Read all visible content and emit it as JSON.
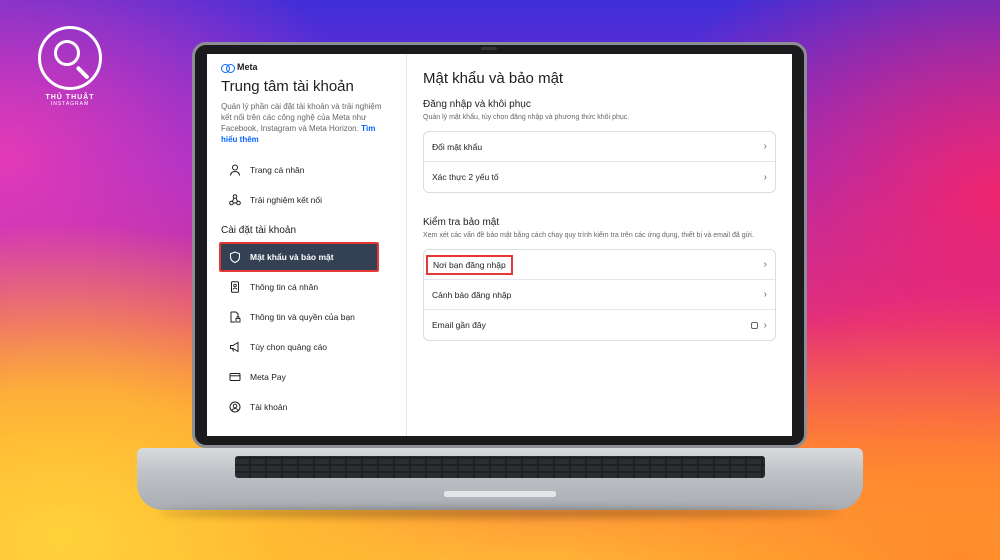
{
  "brand": {
    "line1": "THỦ THUẬT",
    "line2": "INSTAGRAM"
  },
  "sidebar": {
    "meta_label": "Meta",
    "title": "Trung tâm tài khoản",
    "description": "Quản lý phần cài đặt tài khoản và trải nghiệm kết nối trên các công nghệ của Meta như Facebook, Instagram và Meta Horizon.",
    "learn_more": "Tìm hiểu thêm",
    "top_items": [
      {
        "label": "Trang cá nhân",
        "icon": "person-icon"
      },
      {
        "label": "Trải nghiệm kết nối",
        "icon": "connected-icon"
      }
    ],
    "section_label": "Cài đặt tài khoản",
    "settings_items": [
      {
        "label": "Mật khẩu và bảo mật",
        "icon": "shield-icon",
        "active": true
      },
      {
        "label": "Thông tin cá nhân",
        "icon": "id-card-icon"
      },
      {
        "label": "Thông tin và quyền của bạn",
        "icon": "document-lock-icon"
      },
      {
        "label": "Tùy chọn quảng cáo",
        "icon": "megaphone-icon"
      },
      {
        "label": "Meta Pay",
        "icon": "card-icon"
      },
      {
        "label": "Tài khoản",
        "icon": "account-icon"
      }
    ]
  },
  "main": {
    "title": "Mật khẩu và bảo mật",
    "login_section": {
      "heading": "Đăng nhập và khôi phục",
      "subtitle": "Quản lý mật khẩu, tùy chọn đăng nhập và phương thức khôi phục.",
      "rows": [
        "Đổi mật khẩu",
        "Xác thực 2 yếu tố"
      ]
    },
    "security_section": {
      "heading": "Kiểm tra bảo mật",
      "subtitle": "Xem xét các vấn đề bảo mật bằng cách chạy quy trình kiểm tra trên các ứng dụng, thiết bị và email đã gửi.",
      "rows": [
        "Nơi bạn đăng nhập",
        "Cảnh báo đăng nhập",
        "Email gần đây"
      ]
    }
  }
}
